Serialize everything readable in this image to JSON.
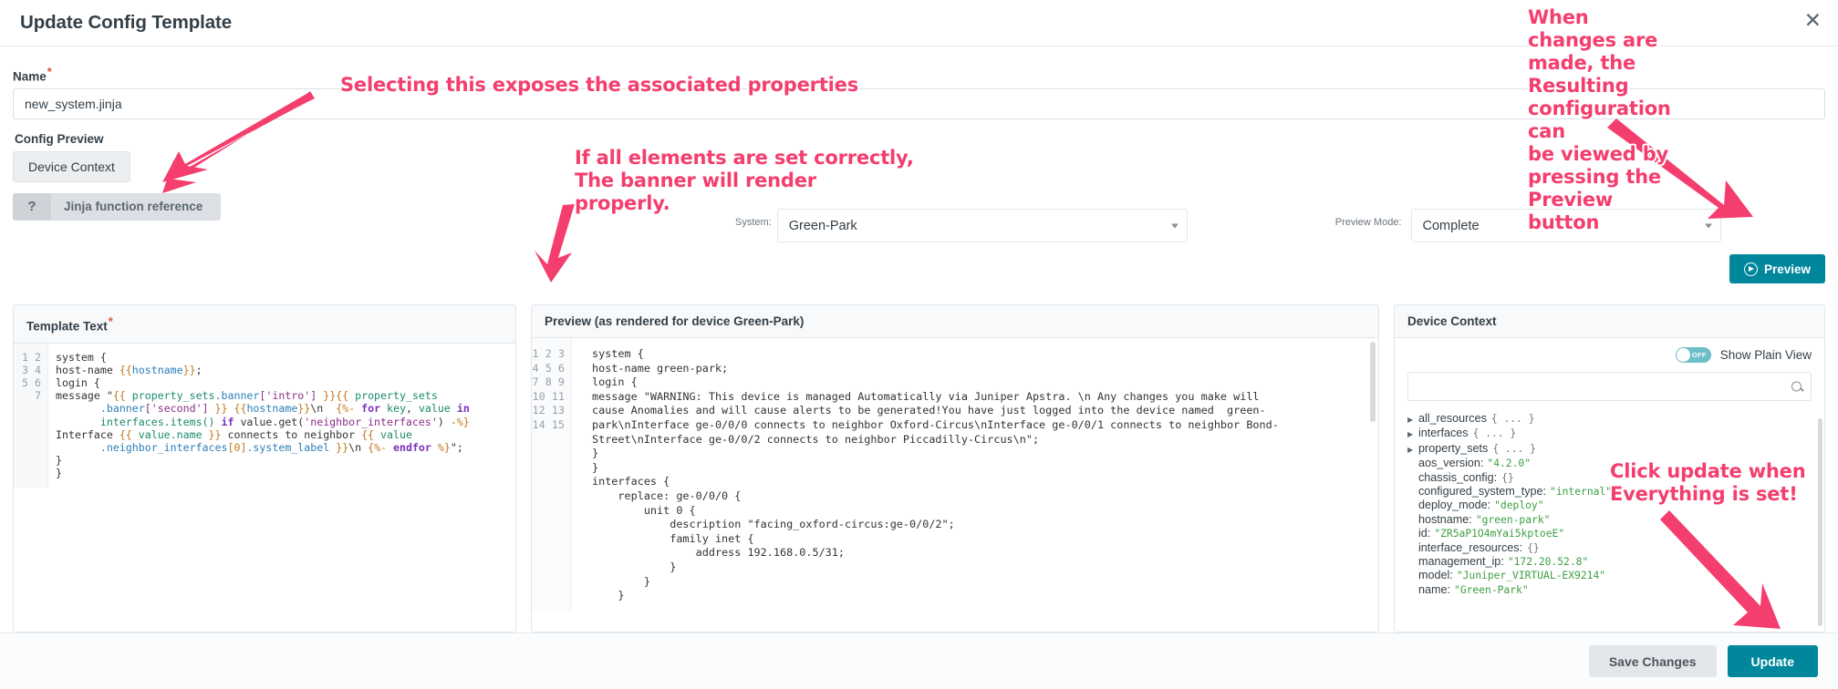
{
  "header": {
    "title": "Update Config Template",
    "close_icon": "close-icon"
  },
  "form": {
    "name_label": "Name",
    "required_mark": "*",
    "name_value": "new_system.jinja",
    "config_preview_label": "Config Preview",
    "device_context_tab": "Device Context",
    "jinja_ref_q": "?",
    "jinja_ref_label": "Jinja function reference",
    "system_label": "System:",
    "system_value": "Green-Park",
    "preview_mode_label": "Preview Mode:",
    "preview_mode_value": "Complete",
    "preview_button": "Preview"
  },
  "template_panel": {
    "title": "Template Text",
    "required_mark": "*",
    "gutter": [
      "1",
      "2",
      "3",
      "4",
      "",
      "",
      "5",
      "",
      "6",
      "7"
    ]
  },
  "preview_panel": {
    "title": "Preview (as rendered for device Green-Park)",
    "gutter": [
      "1",
      "2",
      "3",
      "4",
      "",
      "",
      "",
      "5",
      "6",
      "7",
      "8",
      "9",
      "10",
      "11",
      "12",
      "13",
      "14",
      "15"
    ],
    "lines": [
      "system {",
      "host-name green-park;",
      "login {",
      "message \"WARNING: This device is managed Automatically via Juniper Apstra. \\n Any changes you make will",
      "cause Anomalies and will cause alerts to be generated!You have just logged into the device named  green-",
      "park\\nInterface ge-0/0/0 connects to neighbor Oxford-Circus\\nInterface ge-0/0/1 connects to neighbor Bond-",
      "Street\\nInterface ge-0/0/2 connects to neighbor Piccadilly-Circus\\n\";",
      "}",
      "}",
      "interfaces {",
      "    replace: ge-0/0/0 {",
      "        unit 0 {",
      "            description \"facing_oxford-circus:ge-0/0/2\";",
      "            family inet {",
      "                address 192.168.0.5/31;",
      "            }",
      "        }",
      "    }"
    ]
  },
  "device_context": {
    "title": "Device Context",
    "toggle_state": "OFF",
    "toggle_label": "Show Plain View",
    "search_placeholder": "",
    "search_value": "",
    "search_icon": "search-icon",
    "tree": [
      {
        "expandable": true,
        "key": "all_resources",
        "mono": "{ ... }",
        "value": ""
      },
      {
        "expandable": true,
        "key": "interfaces",
        "mono": "{ ... }",
        "value": ""
      },
      {
        "expandable": true,
        "key": "property_sets",
        "mono": "{ ... }",
        "value": ""
      },
      {
        "expandable": false,
        "key": "aos_version:",
        "mono": "",
        "value": "\"4.2.0\""
      },
      {
        "expandable": false,
        "key": "chassis_config:",
        "mono": "{}",
        "value": ""
      },
      {
        "expandable": false,
        "key": "configured_system_type:",
        "mono": "",
        "value": "\"internal\""
      },
      {
        "expandable": false,
        "key": "deploy_mode:",
        "mono": "",
        "value": "\"deploy\""
      },
      {
        "expandable": false,
        "key": "hostname:",
        "mono": "",
        "value": "\"green-park\""
      },
      {
        "expandable": false,
        "key": "id:",
        "mono": "",
        "value": "\"ZR5aP1O4mYai5kptoeE\""
      },
      {
        "expandable": false,
        "key": "interface_resources:",
        "mono": "{}",
        "value": ""
      },
      {
        "expandable": false,
        "key": "management_ip:",
        "mono": "",
        "value": "\"172.20.52.8\""
      },
      {
        "expandable": false,
        "key": "model:",
        "mono": "",
        "value": "\"Juniper_VIRTUAL-EX9214\""
      },
      {
        "expandable": false,
        "key": "name:",
        "mono": "",
        "value": "\"Green-Park\""
      }
    ]
  },
  "footer": {
    "save_label": "Save Changes",
    "update_label": "Update"
  },
  "annotations": {
    "a1": "Selecting this exposes the associated properties",
    "a2": "If all elements are set correctly,\nThe banner will render\nproperly.",
    "a3": "When changes are made, the\nResulting configuration can\nbe viewed by pressing the\nPreview button",
    "a4": "Click update when\nEverything is set!"
  },
  "colors": {
    "accent": "#00879c",
    "annotation": "#f43e6e",
    "toggle_on": "#6bbfc7",
    "required": "#e8503a"
  }
}
